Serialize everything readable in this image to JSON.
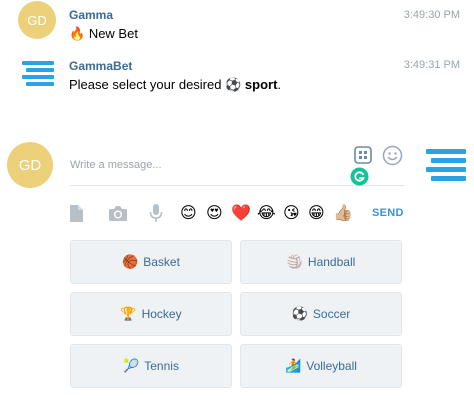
{
  "messages": [
    {
      "avatar_initials": "GD",
      "sender": "Gamma",
      "time": "3:49:30 PM",
      "emoji": "🔥",
      "text": "New Bet"
    },
    {
      "sender": "GammaBet",
      "time": "3:49:31 PM",
      "text_before": "Please select your desired",
      "emoji": "⚽",
      "text_bold": "sport",
      "text_after": "."
    }
  ],
  "composer": {
    "avatar_initials": "GD",
    "placeholder": "Write a message...",
    "quick_emojis": [
      "😊",
      "😍",
      "❤️",
      "😂",
      "😘",
      "😁",
      "👍🏼"
    ],
    "send_label": "SEND"
  },
  "keyboard": {
    "buttons": [
      {
        "emoji": "🏀",
        "label": "Basket"
      },
      {
        "emoji": "🏐",
        "label": "Handball"
      },
      {
        "emoji": "🏆",
        "label": "Hockey"
      },
      {
        "emoji": "⚽",
        "label": "Soccer"
      },
      {
        "emoji": "🎾",
        "label": "Tennis"
      },
      {
        "emoji": "🏄",
        "label": "Volleyball"
      }
    ]
  },
  "colors": {
    "avatar_bg": "#ecd07a",
    "bot_logo": "#2aa3e6",
    "sender_name": "#3d6a94",
    "send_button": "#3a93d6",
    "keyboard_bg": "#eef2f5",
    "grammarly_badge": "#15c39a"
  },
  "icons": [
    "file-icon",
    "camera-icon",
    "microphone-icon",
    "emoji-panel-icon",
    "smiley-icon",
    "bot-commands-icon",
    "grammarly-icon",
    "gammabet-logo-icon"
  ]
}
